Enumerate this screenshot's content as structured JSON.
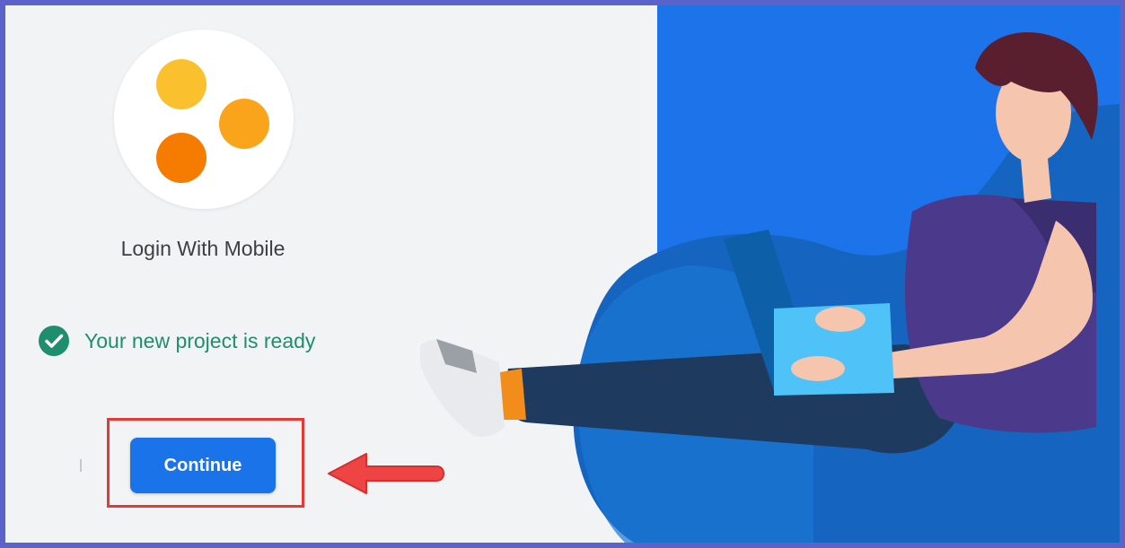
{
  "project": {
    "name": "Login With Mobile"
  },
  "status": {
    "message": "Your new project is ready",
    "icon": "check-circle-icon",
    "color": "#1e8e6e"
  },
  "actions": {
    "continue_label": "Continue"
  },
  "colors": {
    "accent": "#1a73e8",
    "illustration_background": "#1d73e9",
    "highlight": "#e53935",
    "logo_dots": [
      "#fbc02d",
      "#f9a41a",
      "#f57c00"
    ]
  }
}
